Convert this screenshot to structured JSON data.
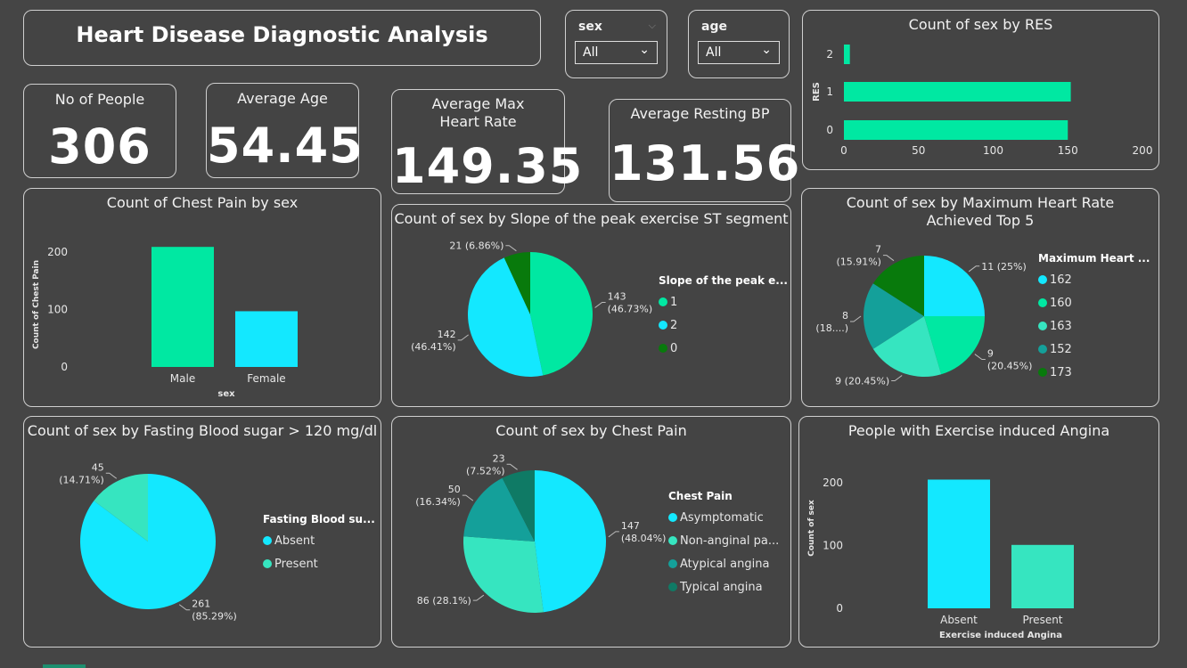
{
  "header": {
    "title": "Heart Disease Diagnostic Analysis"
  },
  "slicers": [
    {
      "label": "sex",
      "value": "All"
    },
    {
      "label": "age",
      "value": "All"
    }
  ],
  "kpis": {
    "people": {
      "label": "No of People",
      "value": "306"
    },
    "age": {
      "label": "Average Age",
      "value": "54.45"
    },
    "maxhr": {
      "label": "Average Max Heart Rate",
      "value": "149.35"
    },
    "bp": {
      "label": "Average Resting BP",
      "value": "131.56"
    }
  },
  "colors": {
    "teal_light": "#00E8A2",
    "cyan": "#13E8FF",
    "dark_green": "#087A0C",
    "aqua": "#36E5C0",
    "teal_mid": "#14A09A",
    "teal_dark": "#0F7A65"
  },
  "chart_data": [
    {
      "id": "res",
      "type": "bar",
      "orientation": "horizontal",
      "title": "Count of sex by RES",
      "ylabel": "RES",
      "categories": [
        "2",
        "1",
        "0"
      ],
      "values": [
        4,
        152,
        150
      ],
      "xlim": [
        0,
        200
      ],
      "xticks": [
        "0",
        "50",
        "100",
        "150",
        "200"
      ],
      "color": "#00E8A2"
    },
    {
      "id": "chestpain_sex",
      "type": "bar",
      "title": "Count of Chest Pain by sex",
      "xlabel": "sex",
      "ylabel": "Count of Chest Pain",
      "categories": [
        "Male",
        "Female"
      ],
      "values": [
        209,
        97
      ],
      "colors": [
        "#00E8A2",
        "#13E8FF"
      ],
      "ylim": [
        0,
        200
      ],
      "yticks": [
        "0",
        "100",
        "200"
      ]
    },
    {
      "id": "slope",
      "type": "pie",
      "title": "Count of sex by Slope of the peak exercise ST segment",
      "legend_title": "Slope of the peak e...",
      "legend_position": "right",
      "slices": [
        {
          "label": "1",
          "value": 143,
          "color": "#00E8A2",
          "l1": "143",
          "l2": "(46.73%)"
        },
        {
          "label": "2",
          "value": 142,
          "color": "#13E8FF",
          "l1": "142",
          "l2": "(46.41%)"
        },
        {
          "label": "0",
          "value": 21,
          "color": "#087A0C",
          "l1": "21 (6.86%)",
          "l2": ""
        }
      ]
    },
    {
      "id": "maxhr_top5",
      "type": "pie",
      "title": "Count of sex by Maximum Heart Rate Achieved Top 5",
      "legend_title": "Maximum Heart ...",
      "legend_position": "right",
      "slices": [
        {
          "label": "162",
          "value": 11,
          "color": "#13E8FF",
          "l1": "11 (25%)",
          "l2": ""
        },
        {
          "label": "160",
          "value": 9,
          "color": "#00E8A2",
          "l1": "9",
          "l2": "(20.45%)"
        },
        {
          "label": "163",
          "value": 9,
          "color": "#36E5C0",
          "l1": "9 (20.45%)",
          "l2": ""
        },
        {
          "label": "152",
          "value": 8,
          "color": "#14A09A",
          "l1": "8",
          "l2": "(18....)"
        },
        {
          "label": "173",
          "value": 7,
          "color": "#087A0C",
          "l1": "7",
          "l2": "(15.91%)"
        }
      ]
    },
    {
      "id": "fbs",
      "type": "pie",
      "title": "Count of sex by Fasting Blood sugar > 120 mg/dl",
      "legend_title": "Fasting Blood su...",
      "legend_position": "right",
      "slices": [
        {
          "label": "Absent",
          "value": 261,
          "color": "#13E8FF",
          "l1": "261",
          "l2": "(85.29%)"
        },
        {
          "label": "Present",
          "value": 45,
          "color": "#36E5C0",
          "l1": "45",
          "l2": "(14.71%)"
        }
      ]
    },
    {
      "id": "chestpain",
      "type": "pie",
      "title": "Count of sex by Chest Pain",
      "legend_title": "Chest Pain",
      "legend_position": "right",
      "slices": [
        {
          "label": "Asymptomatic",
          "value": 147,
          "color": "#13E8FF",
          "l1": "147",
          "l2": "(48.04%)"
        },
        {
          "label": "Non-anginal pa...",
          "value": 86,
          "color": "#36E5C0",
          "l1": "86 (28.1%)",
          "l2": ""
        },
        {
          "label": "Atypical angina",
          "value": 50,
          "color": "#14A09A",
          "l1": "50",
          "l2": "(16.34%)"
        },
        {
          "label": "Typical angina",
          "value": 23,
          "color": "#0F7A65",
          "l1": "23",
          "l2": "(7.52%)"
        }
      ]
    },
    {
      "id": "angina",
      "type": "bar",
      "title": "People with Exercise induced Angina",
      "xlabel": "Exercise induced Angina",
      "ylabel": "Count of sex",
      "categories": [
        "Absent",
        "Present"
      ],
      "values": [
        205,
        101
      ],
      "colors": [
        "#13E8FF",
        "#36E5C0"
      ],
      "ylim": [
        0,
        200
      ],
      "yticks": [
        "0",
        "100",
        "200"
      ]
    }
  ]
}
